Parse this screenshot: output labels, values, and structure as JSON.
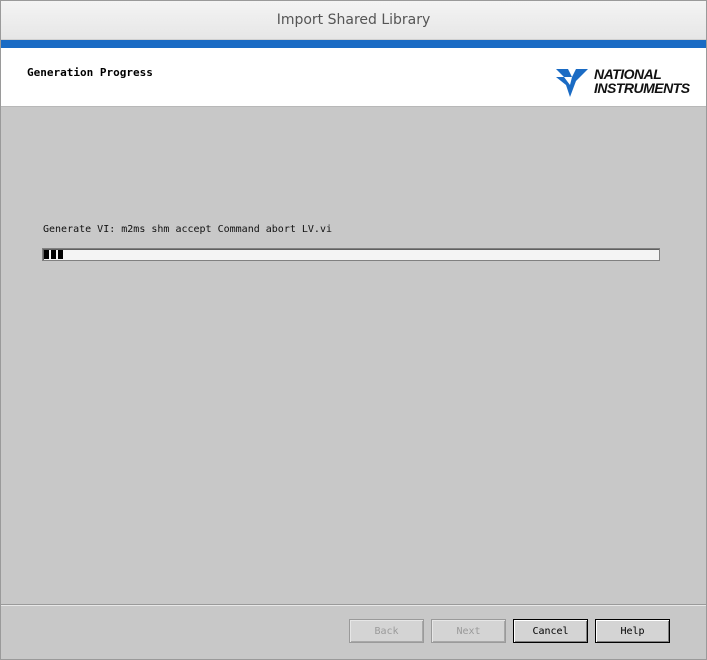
{
  "window": {
    "title": "Import Shared Library"
  },
  "header": {
    "title": "Generation Progress",
    "logo": {
      "line1": "NATIONAL",
      "line2": "INSTRUMENTS",
      "icon": "ni-eagle-icon"
    }
  },
  "main": {
    "status": "Generate VI: m2ms shm accept Command abort LV.vi",
    "progress_fraction": 0.035
  },
  "footer": {
    "back_label": "Back",
    "next_label": "Next",
    "cancel_label": "Cancel",
    "help_label": "Help"
  },
  "colors": {
    "accent": "#1a6bc4",
    "logo_icon": "#1a6bc4"
  }
}
